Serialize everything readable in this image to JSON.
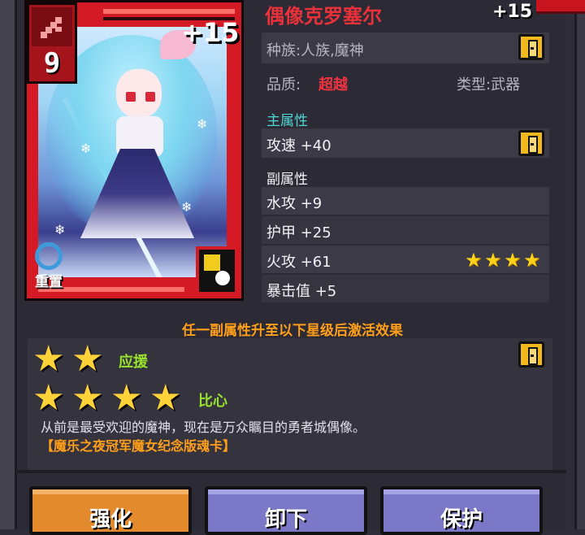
{
  "card": {
    "level": "9",
    "upgrade": "+15",
    "reset_label": "重置"
  },
  "info": {
    "name": "偶像克罗塞尔",
    "name_plus": "+15",
    "race": "种族:人族,魔神",
    "quality_label": "品质:",
    "quality_value": "超越",
    "type": "类型:武器"
  },
  "main_attr": {
    "title": "主属性",
    "value": "攻速 +40"
  },
  "sub_attr": {
    "title": "副属性",
    "items": [
      {
        "text": "水攻 +9",
        "stars": 0
      },
      {
        "text": "护甲 +25",
        "stars": 0
      },
      {
        "text": "火攻 +61",
        "stars": 4
      },
      {
        "text": "暴击值 +5",
        "stars": 0
      }
    ]
  },
  "effect": {
    "title": "任一副属性升至以下星级后激活效果",
    "tiers": [
      {
        "stars": 2,
        "label": "应援"
      },
      {
        "stars": 4,
        "label": "比心"
      }
    ],
    "description": "从前是最受欢迎的魔神，现在是万众瞩目的勇者城偶像。",
    "tag": "【魔乐之夜冠军魔女纪念版魂卡】"
  },
  "buttons": {
    "enhance": "强化",
    "unequip": "卸下",
    "protect": "保护"
  },
  "colors": {
    "card_red": "#d41a24",
    "quality_red": "#f0343f",
    "section_teal": "#4fd6d7",
    "star_gold": "#ffd21a",
    "effect_orange": "#ff9f1a",
    "tier_green": "#98e22e",
    "lock_gold": "#f3b81e"
  }
}
